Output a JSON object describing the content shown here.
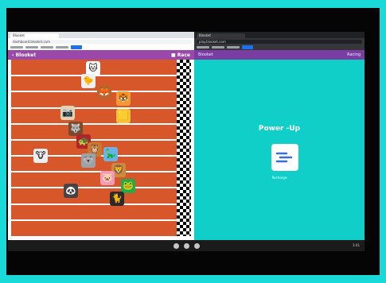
{
  "left_window": {
    "tab_title": "Blooket",
    "url": "dashboard.blooket.com",
    "header_title": "‹ Blooket",
    "header_right": "■ Race"
  },
  "right_window": {
    "tab_title": "Blooket",
    "url": "play.blooket.com",
    "header_left": "Blooket",
    "header_right": "Racing"
  },
  "powerup": {
    "title": "Power -Up",
    "subtitle": "Recharge"
  },
  "race": {
    "lanes": 11,
    "racers": [
      {
        "icon": "🐱",
        "color": "#ffffff"
      },
      {
        "icon": "🐤",
        "color": "#f0f0f0"
      },
      {
        "icon": "🦊",
        "color": "#c0632a"
      },
      {
        "icon": "🐯",
        "color": "#f19a36"
      },
      {
        "icon": "🟨",
        "color": "#f6c23c"
      },
      {
        "icon": "📷",
        "color": "#e2d3b4"
      },
      {
        "icon": "🐺",
        "color": "#7a4a2c"
      },
      {
        "icon": "🐢",
        "color": "#b2242c"
      },
      {
        "icon": "🦉",
        "color": "#c9782f"
      },
      {
        "icon": "🦕",
        "color": "#6ab3e8"
      },
      {
        "icon": "🐮",
        "color": "#eeeeee"
      },
      {
        "icon": "🐨",
        "color": "#9ba3a9"
      },
      {
        "icon": "🦁",
        "color": "#c98b3e"
      },
      {
        "icon": "🐷",
        "color": "#f29bb8"
      },
      {
        "icon": "🐸",
        "color": "#29a84a"
      },
      {
        "icon": "🐼",
        "color": "#444444"
      },
      {
        "icon": "🐈",
        "color": "#2a2a2a"
      }
    ]
  },
  "colors": {
    "track": "#d7572b",
    "purple": "#9a49aa",
    "teal": "#0fcfc8"
  },
  "taskbar": {
    "clock": "3:41"
  }
}
